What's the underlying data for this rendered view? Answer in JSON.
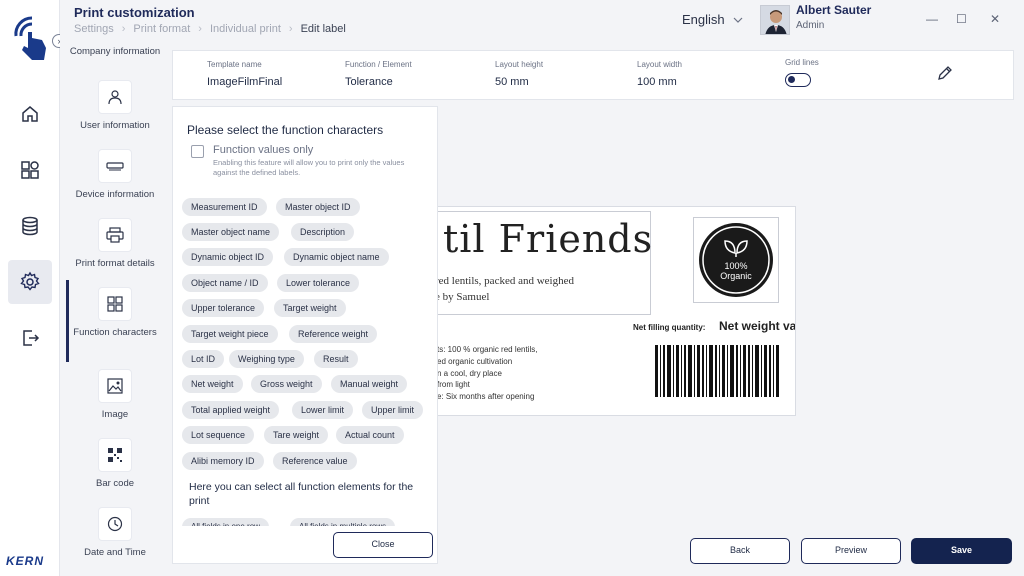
{
  "header": {
    "title": "Print customization",
    "breadcrumbs": [
      "Settings",
      "Print format",
      "Individual print",
      "Edit label"
    ],
    "language": "English",
    "user_name": "Albert Sauter",
    "user_role": "Admin"
  },
  "rail": {
    "brand": "KERN"
  },
  "function_nav": [
    {
      "label": "Company information",
      "icon": "building-icon"
    },
    {
      "label": "User information",
      "icon": "user-icon"
    },
    {
      "label": "Device information",
      "icon": "device-icon"
    },
    {
      "label": "Print format details",
      "icon": "printer-icon"
    },
    {
      "label": "Function characters",
      "icon": "grid-icon"
    },
    {
      "label": "Image",
      "icon": "image-icon"
    },
    {
      "label": "Bar code",
      "icon": "qr-icon"
    },
    {
      "label": "Date and Time",
      "icon": "clock-icon"
    }
  ],
  "props": {
    "template_name_label": "Template name",
    "template_name": "ImageFilmFinal",
    "function_label": "Function / Element",
    "function_value": "Tolerance",
    "layout_height_label": "Layout height",
    "layout_height": "50 mm",
    "layout_width_label": "Layout width",
    "layout_width": "100 mm",
    "grid_lines_label": "Grid lines",
    "grid_lines_on": false
  },
  "panel": {
    "title": "Please select the function characters",
    "checkbox_label": "Function values only",
    "checkbox_hint": "Enabling this feature will allow you to print only the values against the defined labels.",
    "chips": [
      "Measurement ID",
      "Master object ID",
      "Master object name",
      "Description",
      "Dynamic object ID",
      "Dynamic object name",
      "Object name / ID",
      "Lower tolerance",
      "Upper tolerance",
      "Target weight",
      "Target weight piece",
      "Reference weight",
      "Lot ID",
      "Weighing type",
      "Result",
      "Net weight",
      "Gross weight",
      "Manual weight",
      "Total applied weight",
      "Lower limit",
      "Upper limit",
      "Lot sequence",
      "Tare weight",
      "Actual count",
      "Alibi memory ID",
      "Reference value"
    ],
    "note": "Here you can select all function elements for the print",
    "partial_chips": [
      "All fields in one row",
      "All fields in multiple rows"
    ],
    "close_label": "Close"
  },
  "label_preview": {
    "brand_text": "til Friends",
    "sub_line_1": "red lentils, packed and weighed",
    "sub_line_2": "e by Samuel",
    "logo_text_1": "100%",
    "logo_text_2": "Organic",
    "net_filling_label": "Net filling quantity:",
    "net_weight_value": "Net weight va",
    "details": [
      "ts:  100 % organic red lentils,",
      "ed organic cultivation",
      "n a cool, dry place",
      "from light",
      "e:  Six months after opening"
    ]
  },
  "actions": {
    "back": "Back",
    "preview": "Preview",
    "save": "Save"
  },
  "colors": {
    "primary": "#14234f",
    "chip_bg": "#e6e8ec"
  }
}
